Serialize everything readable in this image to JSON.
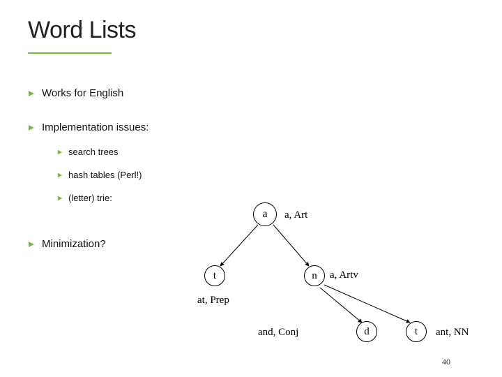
{
  "title": "Word Lists",
  "bullets": [
    {
      "text": "Works for English"
    },
    {
      "text": "Implementation issues:",
      "sub": [
        {
          "text": "search trees"
        },
        {
          "text": "hash tables (Perl!)"
        },
        {
          "text": "(letter) trie:"
        }
      ]
    },
    {
      "text": "Minimization?"
    }
  ],
  "trie": {
    "nodes": {
      "a": "a",
      "t": "t",
      "n": "n",
      "d": "d",
      "t2": "t"
    },
    "labels": {
      "a_art": "a, Art",
      "a_artv": "a, Artv",
      "at_prep": "at, Prep",
      "and_conj": "and, Conj",
      "ant_nn": "ant, NN"
    }
  },
  "page_number": "40",
  "accent_color": "#6fbf3f"
}
